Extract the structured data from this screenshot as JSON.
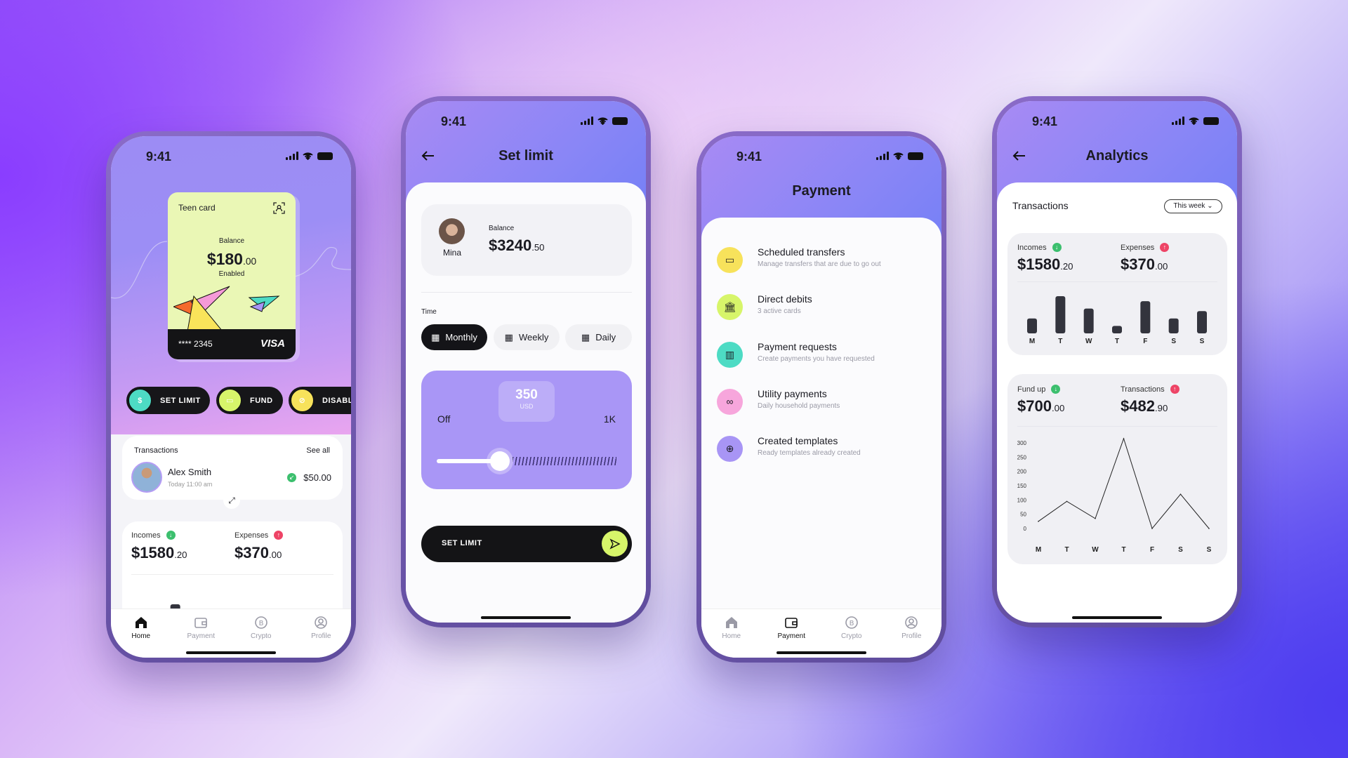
{
  "status": {
    "time": "9:41"
  },
  "colors": {
    "accent_lime": "#d7f56a",
    "accent_teal": "#4ddbc4",
    "accent_yellow": "#f7e25b",
    "accent_pink": "#f7a6dc",
    "accent_purple": "#a895f5",
    "income_green": "#3cbf6e",
    "expense_red": "#ee4466",
    "dark": "#161619"
  },
  "tabs": [
    {
      "label": "Home",
      "icon": "home-icon"
    },
    {
      "label": "Payment",
      "icon": "wallet-icon"
    },
    {
      "label": "Crypto",
      "icon": "bitcoin-icon"
    },
    {
      "label": "Profile",
      "icon": "profile-icon"
    }
  ],
  "home": {
    "card": {
      "name": "Teen card",
      "balance_label": "Balance",
      "balance_main": "$180",
      "balance_cents": ".00",
      "status": "Enabled",
      "number": "**** 2345",
      "brand": "VISA"
    },
    "actions": [
      {
        "label": "SET LIMIT",
        "icon": "money-bag-icon",
        "color": "#4ddbc4"
      },
      {
        "label": "FUND",
        "icon": "cash-icon",
        "color": "#d7f56a"
      },
      {
        "label": "DISABLE",
        "icon": "block-icon",
        "color": "#f7e25b"
      }
    ],
    "transactions": {
      "title": "Transactions",
      "see_all": "See all",
      "name": "Alex Smith",
      "time": "Today 11:00 am",
      "amount": "$50.00"
    },
    "incomes": {
      "label": "Incomes",
      "main": "$1580",
      "cents": ".20"
    },
    "expenses": {
      "label": "Expenses",
      "main": "$370",
      "cents": ".00"
    },
    "active_tab": "Home"
  },
  "set_limit": {
    "title": "Set limit",
    "user": "Mina",
    "balance_label": "Balance",
    "balance_main": "$3240",
    "balance_cents": ".50",
    "time_label": "Time",
    "periods": [
      "Monthly",
      "Weekly",
      "Daily"
    ],
    "selected_period": "Monthly",
    "value": "350",
    "currency": "USD",
    "min_label": "Off",
    "max_label": "1K",
    "slider_fraction": 0.35,
    "button": "SET LIMIT"
  },
  "payment": {
    "title": "Payment",
    "items": [
      {
        "title": "Scheduled transfers",
        "subtitle": "Manage transfers that are due to go out",
        "icon": "cash-icon",
        "color": "#f7e25b"
      },
      {
        "title": "Direct debits",
        "subtitle": "3 active cards",
        "icon": "bank-icon",
        "color": "#d7f56a"
      },
      {
        "title": "Payment requests",
        "subtitle": "Create payments you have requested",
        "icon": "building-icon",
        "color": "#4ddbc4"
      },
      {
        "title": "Utility payments",
        "subtitle": "Daily household payments",
        "icon": "link-icon",
        "color": "#f7a6dc"
      },
      {
        "title": "Created templates",
        "subtitle": "Ready templates already created",
        "icon": "globe-icon",
        "color": "#a895f5"
      }
    ],
    "active_tab": "Payment"
  },
  "analytics": {
    "title": "Analytics",
    "section": "Transactions",
    "range": "This week",
    "incomes": {
      "label": "Incomes",
      "main": "$1580",
      "cents": ".20"
    },
    "expenses": {
      "label": "Expenses",
      "main": "$370",
      "cents": ".00"
    },
    "fund_up": {
      "label": "Fund up",
      "main": "$700",
      "cents": ".00"
    },
    "transactions": {
      "label": "Transactions",
      "main": "$482",
      "cents": ".90"
    }
  },
  "chart_data": [
    {
      "type": "bar",
      "categories": [
        "M",
        "T",
        "W",
        "T",
        "F",
        "S",
        "S"
      ],
      "values": [
        30,
        75,
        50,
        15,
        65,
        30,
        45
      ]
    },
    {
      "type": "line",
      "categories": [
        "M",
        "T",
        "W",
        "T",
        "F",
        "S",
        "S"
      ],
      "values": [
        25,
        95,
        35,
        315,
        0,
        120,
        0
      ],
      "ylim": [
        0,
        300
      ],
      "yticks": [
        "300",
        "250",
        "200",
        "150",
        "100",
        "50",
        "0"
      ],
      "grid": false
    }
  ]
}
